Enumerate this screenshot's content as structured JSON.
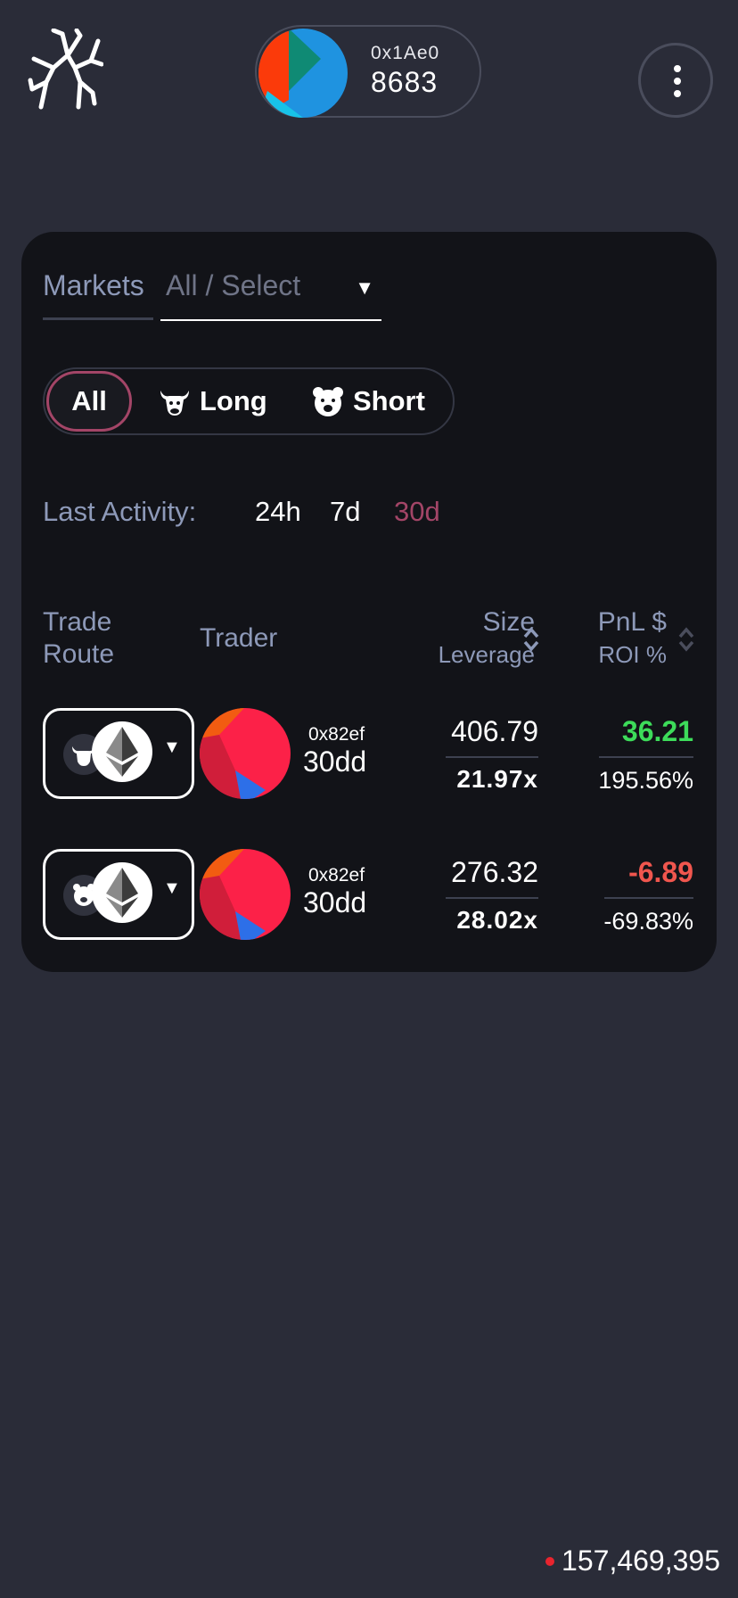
{
  "header": {
    "logo": "tree-branch-logo-icon",
    "account": {
      "short_address": "0x1Ae0",
      "number": "8683"
    },
    "menu_icon": "vertical-dots-icon"
  },
  "filters": {
    "markets_label": "Markets",
    "market_select_value": "All / Select",
    "side_options": [
      {
        "label": "All",
        "icon": "",
        "active": true
      },
      {
        "label": "Long",
        "icon": "bull-icon",
        "active": false
      },
      {
        "label": "Short",
        "icon": "bear-icon",
        "active": false
      }
    ],
    "activity_label": "Last Activity:",
    "activity_options": [
      {
        "label": "24h",
        "active": false
      },
      {
        "label": "7d",
        "active": false
      },
      {
        "label": "30d",
        "active": true
      }
    ]
  },
  "table": {
    "columns": {
      "trade_route_line1": "Trade",
      "trade_route_line2": "Route",
      "trader": "Trader",
      "size": "Size",
      "leverage": "Leverage",
      "pnl": "PnL $",
      "roi": "ROI %"
    },
    "rows": [
      {
        "side_icon": "bull-icon",
        "asset_icon": "ethereum-icon",
        "trader_short": "0x82ef",
        "trader_name": "30dd",
        "size": "406.79",
        "leverage": "21.97x",
        "pnl": "36.21",
        "pnl_color": "#3ddc5a",
        "roi": "195.56%"
      },
      {
        "side_icon": "bear-icon",
        "asset_icon": "ethereum-icon",
        "trader_short": "0x82ef",
        "trader_name": "30dd",
        "size": "276.32",
        "leverage": "28.02x",
        "pnl": "-6.89",
        "pnl_color": "#f0564e",
        "roi": "-69.83%"
      }
    ]
  },
  "footer": {
    "counter": "157,469,395",
    "status_color": "#e8242e"
  },
  "colors": {
    "background": "#2a2c38",
    "card": "#121318",
    "accent": "#a34567",
    "muted": "#8d99b8"
  }
}
